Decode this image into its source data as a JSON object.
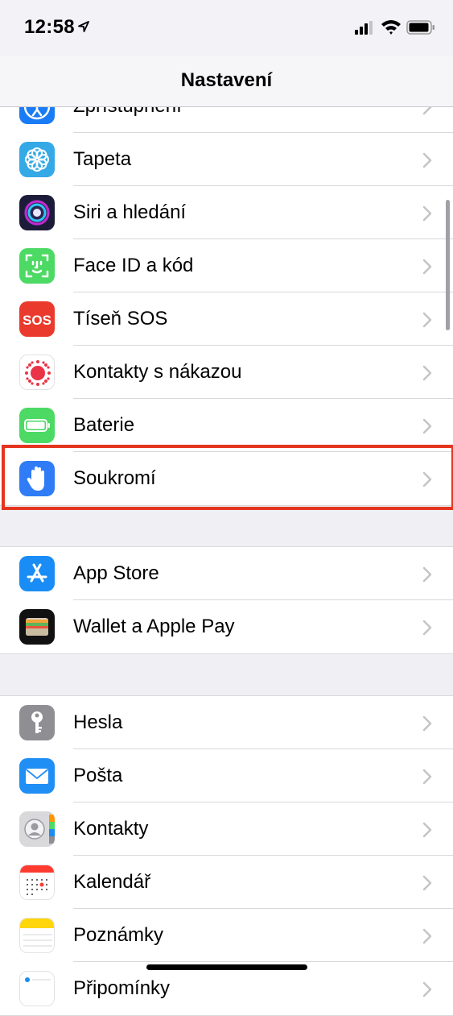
{
  "status_bar": {
    "time": "12:58"
  },
  "nav": {
    "title": "Nastavení"
  },
  "group1": {
    "items": [
      {
        "label": "Zpřístupnění",
        "icon": "accessibility-icon",
        "color": "#1a7cf5"
      },
      {
        "label": "Tapeta",
        "icon": "wallpaper-flower-icon",
        "color": "#35a9e6"
      },
      {
        "label": "Siri a hledání",
        "icon": "siri-icon",
        "color": "#1c1c3a"
      },
      {
        "label": "Face ID a kód",
        "icon": "face-id-icon",
        "color": "#4cd964"
      },
      {
        "label": "Tíseň SOS",
        "icon": "sos-icon",
        "color": "#ea3a2d",
        "icon_text": "SOS"
      },
      {
        "label": "Kontakty s nákazou",
        "icon": "exposure-notification-icon",
        "color": "#ea3346"
      },
      {
        "label": "Baterie",
        "icon": "battery-icon",
        "color": "#4cd964"
      },
      {
        "label": "Soukromí",
        "icon": "privacy-hand-icon",
        "color": "#2f7cf6"
      }
    ]
  },
  "group2": {
    "items": [
      {
        "label": "App Store",
        "icon": "app-store-icon",
        "color": "#1a8cf5"
      },
      {
        "label": "Wallet a Apple Pay",
        "icon": "wallet-icon",
        "color": "#111111"
      }
    ]
  },
  "group3": {
    "items": [
      {
        "label": "Hesla",
        "icon": "key-icon",
        "color": "#8e8e93"
      },
      {
        "label": "Pošta",
        "icon": "mail-icon",
        "color": "#1f8ef5"
      },
      {
        "label": "Kontakty",
        "icon": "contacts-icon",
        "color": "#c9c9cc"
      },
      {
        "label": "Kalendář",
        "icon": "calendar-icon",
        "color": "#ffffff"
      },
      {
        "label": "Poznámky",
        "icon": "notes-icon",
        "color": "#ffd60a"
      },
      {
        "label": "Připomínky",
        "icon": "reminders-icon",
        "color": "#ffffff"
      }
    ]
  }
}
